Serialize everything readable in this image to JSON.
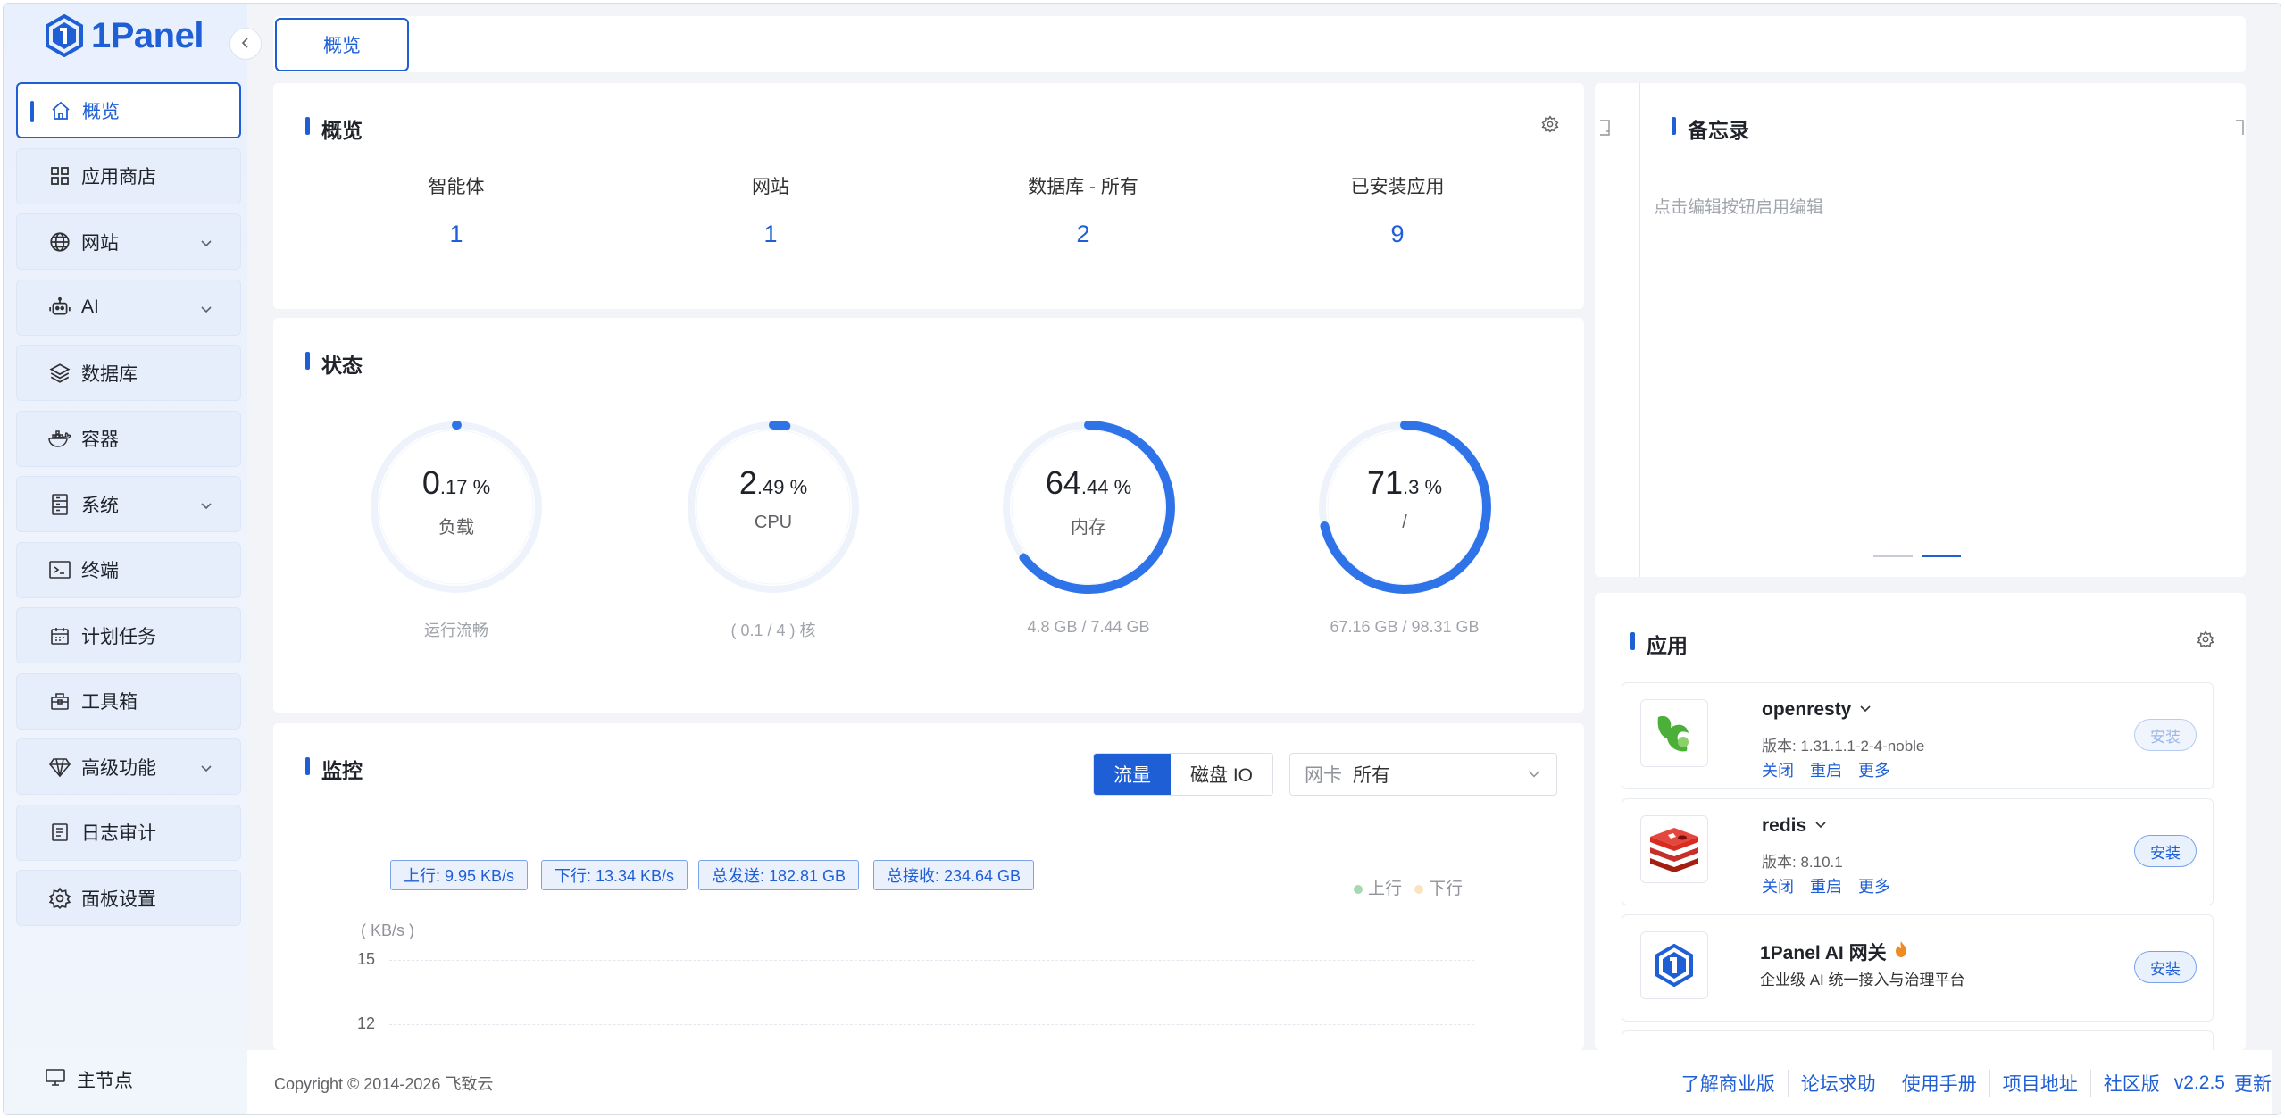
{
  "brand": {
    "name": "1Panel",
    "accent": "#1f5fd6"
  },
  "sidebar": {
    "items": [
      {
        "label": "概览",
        "icon": "home-icon",
        "active": true,
        "expandable": false
      },
      {
        "label": "应用商店",
        "icon": "grid-icon",
        "active": false,
        "expandable": false
      },
      {
        "label": "网站",
        "icon": "globe-icon",
        "active": false,
        "expandable": true
      },
      {
        "label": "AI",
        "icon": "robot-icon",
        "active": false,
        "expandable": true
      },
      {
        "label": "数据库",
        "icon": "layers-icon",
        "active": false,
        "expandable": false
      },
      {
        "label": "容器",
        "icon": "docker-icon",
        "active": false,
        "expandable": false
      },
      {
        "label": "系统",
        "icon": "server-icon",
        "active": false,
        "expandable": true
      },
      {
        "label": "终端",
        "icon": "terminal-icon",
        "active": false,
        "expandable": false
      },
      {
        "label": "计划任务",
        "icon": "calendar-icon",
        "active": false,
        "expandable": false
      },
      {
        "label": "工具箱",
        "icon": "toolbox-icon",
        "active": false,
        "expandable": false
      },
      {
        "label": "高级功能",
        "icon": "diamond-icon",
        "active": false,
        "expandable": true
      },
      {
        "label": "日志审计",
        "icon": "log-icon",
        "active": false,
        "expandable": false
      },
      {
        "label": "面板设置",
        "icon": "gear-icon",
        "active": false,
        "expandable": false
      }
    ],
    "node_label": "主节点"
  },
  "tabs": {
    "active_tab": "概览"
  },
  "overview": {
    "title": "概览",
    "items": [
      {
        "label": "智能体",
        "value": "1"
      },
      {
        "label": "网站",
        "value": "1"
      },
      {
        "label": "数据库 - 所有",
        "value": "2"
      },
      {
        "label": "已安装应用",
        "value": "9"
      }
    ]
  },
  "status": {
    "title": "状态",
    "gauges": [
      {
        "int": "0",
        "dec": ".17",
        "unit": " %",
        "percent": 0.17,
        "name": "负载",
        "sub": "运行流畅"
      },
      {
        "int": "2",
        "dec": ".49",
        "unit": " %",
        "percent": 2.49,
        "name": "CPU",
        "sub": "( 0.1 / 4 ) 核"
      },
      {
        "int": "64",
        "dec": ".44",
        "unit": " %",
        "percent": 64.44,
        "name": "内存",
        "sub": "4.8 GB / 7.44 GB"
      },
      {
        "int": "71",
        "dec": ".3",
        "unit": " %",
        "percent": 71.3,
        "name": "/",
        "sub": "67.16 GB / 98.31 GB"
      }
    ]
  },
  "monitor": {
    "title": "监控",
    "seg_traffic": "流量",
    "seg_disk": "磁盘 IO",
    "nic_prefix": "网卡",
    "nic_value": "所有",
    "chips": {
      "up": "上行: 9.95 KB/s",
      "down": "下行: 13.34 KB/s",
      "sent": "总发送: 182.81 GB",
      "recv": "总接收: 234.64 GB"
    },
    "legend_up": "上行",
    "legend_down": "下行",
    "legend_up_color": "#a8d8b0",
    "legend_down_color": "#fbe3c0",
    "y_unit": "( KB/s )",
    "y_ticks": [
      "15",
      "12"
    ]
  },
  "notes": {
    "title": "备忘录",
    "hint": "点击编辑按钮启用编辑"
  },
  "apps": {
    "title": "应用",
    "list": [
      {
        "name": "openresty",
        "version": "版本: 1.31.1.1-2-4-noble",
        "links": [
          "关闭",
          "重启",
          "更多"
        ],
        "button": "安装",
        "disabled": true
      },
      {
        "name": "redis",
        "version": "版本: 8.10.1",
        "links": [
          "关闭",
          "重启",
          "更多"
        ],
        "button": "安装",
        "disabled": false
      },
      {
        "name": "1Panel AI 网关",
        "desc": "企业级 AI 统一接入与治理平台",
        "button": "安装",
        "disabled": false
      }
    ]
  },
  "footer": {
    "copyright": "Copyright © 2014-2026 飞致云",
    "links": [
      "了解商业版",
      "论坛求助",
      "使用手册",
      "项目地址",
      "社区版"
    ],
    "version": "v2.2.5",
    "update": "更新"
  }
}
